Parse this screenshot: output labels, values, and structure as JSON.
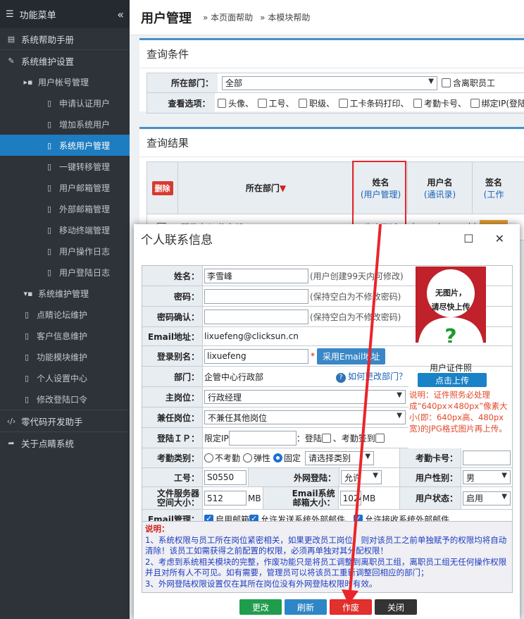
{
  "sidebar": {
    "header": "功能菜单",
    "items": [
      {
        "label": "系统帮助手册",
        "icon": "book-icon"
      },
      {
        "label": "系统维护设置",
        "icon": "wrench-icon"
      },
      {
        "label": "用户帐号管理",
        "icon": "folder-open-icon"
      },
      {
        "label": "申请认证用户",
        "icon": "file-icon"
      },
      {
        "label": "增加系统用户",
        "icon": "file-icon"
      },
      {
        "label": "系统用户管理",
        "icon": "file-icon"
      },
      {
        "label": "一键转移管理",
        "icon": "file-icon"
      },
      {
        "label": "用户邮箱管理",
        "icon": "file-icon"
      },
      {
        "label": "外部邮箱管理",
        "icon": "file-icon"
      },
      {
        "label": "移动终端管理",
        "icon": "file-icon"
      },
      {
        "label": "用户操作日志",
        "icon": "file-icon"
      },
      {
        "label": "用户登陆日志",
        "icon": "file-icon"
      },
      {
        "label": "系统维护管理",
        "icon": "folder-icon"
      },
      {
        "label": "点睛论坛维护",
        "icon": "file-icon"
      },
      {
        "label": "客户信息维护",
        "icon": "file-icon"
      },
      {
        "label": "功能模块维护",
        "icon": "file-icon"
      },
      {
        "label": "个人设置中心",
        "icon": "file-icon"
      },
      {
        "label": "修改登陆口令",
        "icon": "file-icon"
      },
      {
        "label": "零代码开发助手",
        "icon": "code-icon"
      },
      {
        "label": "关于点睛系统",
        "icon": "share-icon"
      }
    ]
  },
  "header": {
    "title": "用户管理",
    "help1": "» 本页面帮助",
    "help2": "» 本模块帮助"
  },
  "query": {
    "title": "查询条件",
    "dept_label": "所在部门：",
    "dept_value": "全部",
    "include_resigned": "含离职员工",
    "items_label": "查看选项：",
    "options": [
      "头像、",
      "工号、",
      "职级、",
      "工卡条码打印、",
      "考勤卡号、",
      "绑定IP(登陆"
    ]
  },
  "results": {
    "title": "查询结果",
    "delete_btn": "删除",
    "col_dept": "所在部门",
    "col_dept_arrow": "▼",
    "col_name": "姓名",
    "col_name_sub": "(用户管理)",
    "col_user": "用户名",
    "col_user_sub": "(通讯录)",
    "col_sign": "签名",
    "col_sign_sub": "(工作",
    "row_dept": "研发中心:信息部",
    "row_name": "生产测试",
    "row_user": "shengchanceshi"
  },
  "dialog": {
    "title": "个人联系信息",
    "name_label": "姓名：",
    "name_value": "李雪峰",
    "name_note": "(用户创建99天内可修改)",
    "pwd_label": "密码：",
    "pwd_note": "(保持空白为不修改密码)",
    "pwd2_label": "密码确认：",
    "pwd2_note": "(保持空白为不修改密码)",
    "email_label": "Email地址：",
    "email_value": "lixuefeng@clicksun.cn",
    "alias_label": "登录别名：",
    "alias_value": "lixuefeng",
    "alias_star": "*",
    "use_email_btn": "采用Email地址",
    "dept_label": "部门：",
    "dept_value": "企管中心行政部",
    "change_dept": "如何更改部门？",
    "main_post_label": "主岗位：",
    "main_post_value": "行政经理",
    "part_post_label": "兼任岗位：",
    "part_post_value": "不兼任其他岗位",
    "ip_label": "登陆ＩＰ：",
    "ip_limit": "限定IP",
    "ip_login": "：登陆",
    "ip_attend": "、考勤签到",
    "attend_type_label": "考勤类别：",
    "attend_opts": [
      "不考勤",
      "弹性",
      "固定"
    ],
    "attend_select": "请选择类别",
    "card_label": "考勤卡号：",
    "jobno_label": "工号：",
    "jobno_value": "S0550",
    "extlogin_label": "外网登陆：",
    "extlogin_value": "允许",
    "gender_label": "用户性别：",
    "gender_value": "男",
    "fs_label_1": "文件服务器",
    "fs_label_2": "空间大小：",
    "fs_value": "512",
    "fs_unit": "MB",
    "mb_label_1": "Email系统",
    "mb_label_2": "邮箱大小：",
    "mb_value": "1024",
    "mb_unit": "MB",
    "status_label": "用户状态：",
    "status_value": "启用",
    "emailmgr_label": "Email管理：",
    "emailmgr_opts": [
      "启用邮箱",
      "允许发送系统外部邮件、",
      "允许接收系统外部邮件"
    ],
    "photo_text1": "无图片，",
    "photo_text2": "请尽快上传",
    "photo_q": "?",
    "photo_caption": "用户证件照",
    "upload_btn": "点击上传",
    "photo_note": "说明：证件照务必处理成“640px×480px”像素大小(即：640px高、480px宽)的JPG格式图片再上传。",
    "explain_title": "说明：",
    "explain_lines": [
      "1、系统权限与员工所在岗位紧密相关，如果更改员工岗位，则对该员工之前单独赋予的权限均将自动清除！该员工如需获得之前配置的权限，必须再单独对其分配权限！",
      "2、考虑到系统相关模块的完整，作废功能只是将员工调整到离职员工组，离职员工组无任何操作权限并且对所有人不可见。如有需要，管理员可以将该员工重新调整回相应的部门；",
      "3、外网登陆权限设置仅在其所在岗位没有外网登陆权限时有效。"
    ],
    "btn_update": "更改",
    "btn_refresh": "刷新",
    "btn_void": "作废",
    "btn_close": "关闭"
  },
  "colors": {
    "accent": "#1e7cc0",
    "annotation": "#e8262b",
    "sidebar": "#2d3339"
  }
}
